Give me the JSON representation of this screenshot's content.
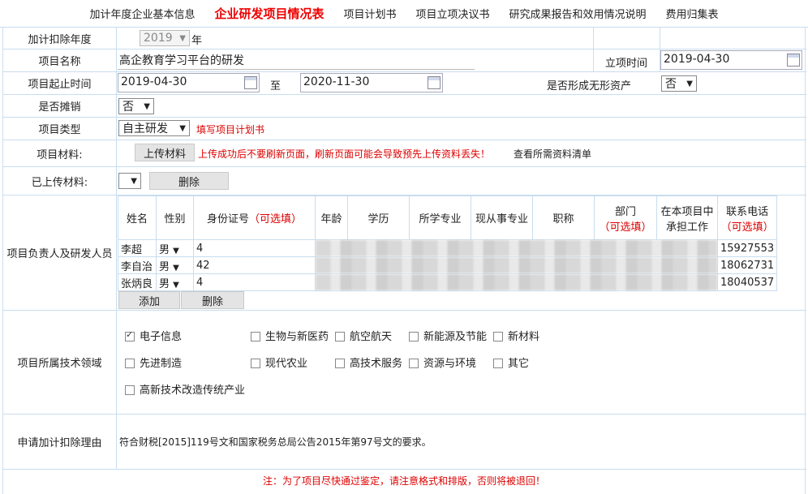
{
  "tabs": [
    "加计年度企业基本信息",
    "企业研发项目情况表",
    "项目计划书",
    "项目立项决议书",
    "研究成果报告和效用情况说明",
    "费用归集表"
  ],
  "form": {
    "year_label": "加计扣除年度",
    "year_value": "2019",
    "year_unit": "年",
    "project_name_label": "项目名称",
    "project_name": "高企教育学习平台的研发",
    "approval_time_label": "立项时间",
    "approval_time": "2019-04-30",
    "period_label": "项目起止时间",
    "start_date": "2019-04-30",
    "to": "至",
    "end_date": "2020-11-30",
    "intangible_label": "是否形成无形资产",
    "intangible_value": "否",
    "amortize_label": "是否摊销",
    "amortize_value": "否",
    "type_label": "项目类型",
    "type_value": "自主研发",
    "type_link": "填写项目计划书",
    "material_label": "项目材料:",
    "upload_button": "上传材料",
    "upload_warning": "上传成功后不要刷新页面，刷新页面可能会导致预先上传资料丢失！",
    "upload_info": "查看所需资料清单",
    "uploaded_label": "已上传材料:",
    "delete_button": "删除"
  },
  "personnel": {
    "label": "项目负责人及研发人员",
    "headers": {
      "name": "姓名",
      "gender": "性别",
      "id_main": "身份证号",
      "id_opt": "（可选填）",
      "age": "年龄",
      "edu": "学历",
      "major": "所学专业",
      "job_major": "现从事专业",
      "title": "职称",
      "dept": "部门",
      "dept_opt": "（可选填）",
      "role_1": "在本项目中",
      "role_2": "承担工作",
      "phone": "联系电话",
      "phone_opt": "（可选填）"
    },
    "rows": [
      {
        "name": "李超",
        "gender": "男",
        "id": "4",
        "phone": "15927553"
      },
      {
        "name": "李自治",
        "gender": "男",
        "id": "42",
        "phone": "18062731"
      },
      {
        "name": "张炳良",
        "gender": "男",
        "id": "4",
        "phone": "18040537"
      }
    ],
    "add_button": "添加",
    "delete_button": "删除"
  },
  "tech": {
    "label": "项目所属技术领域",
    "options": [
      {
        "text": "电子信息",
        "checked": true
      },
      {
        "text": "生物与新医药",
        "checked": false
      },
      {
        "text": "航空航天",
        "checked": false
      },
      {
        "text": "新能源及节能",
        "checked": false
      },
      {
        "text": "新材料",
        "checked": false
      },
      {
        "text": "先进制造",
        "checked": false
      },
      {
        "text": "现代农业",
        "checked": false
      },
      {
        "text": "高技术服务",
        "checked": false
      },
      {
        "text": "资源与环境",
        "checked": false
      },
      {
        "text": "其它",
        "checked": false
      },
      {
        "text": "高新技术改造传统产业",
        "checked": false
      }
    ]
  },
  "reason": {
    "label": "申请加计扣除理由",
    "text": "符合财税[2015]119号文和国家税务总局公告2015年第97号文的要求。"
  },
  "notice": "注：为了项目尽快通过鉴定，请注意格式和排版，否则将被退回！"
}
